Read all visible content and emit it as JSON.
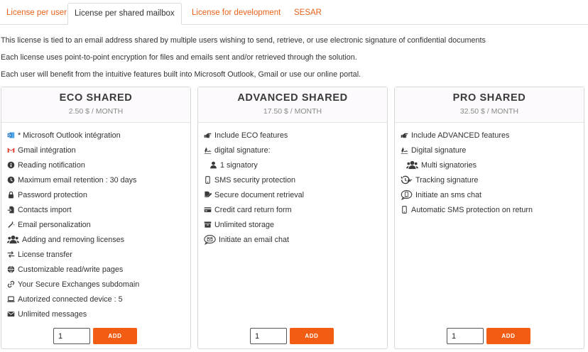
{
  "tabs": [
    {
      "label": "License per user",
      "active": false
    },
    {
      "label": "License per shared mailbox",
      "active": true
    },
    {
      "label": "License for development",
      "active": false
    },
    {
      "label": "SESAR",
      "active": false
    }
  ],
  "intro": [
    "This license is tied to an email address shared by multiple users wishing to send, retrieve, or use electronic signature of confidential documents",
    "Each license uses point-to-point encryption for files and emails sent and/or retrieved through the solution.",
    "Each user will benefit from the intuitive features built into Microsoft Outlook, Gmail or use our online portal."
  ],
  "plans": [
    {
      "title": "ECO SHARED",
      "price": "2.50 $ / MONTH",
      "features": [
        {
          "icon": "outlook-icon",
          "label": "* Microsoft Outlook intégration"
        },
        {
          "icon": "gmail-icon",
          "label": "Gmail intégration"
        },
        {
          "icon": "info-circle-icon",
          "label": "Reading notification"
        },
        {
          "icon": "clock-icon",
          "label": "Maximum email retention : 30 days"
        },
        {
          "icon": "lock-icon",
          "label": "Password protection"
        },
        {
          "icon": "file-import-icon",
          "label": "Contacts import"
        },
        {
          "icon": "magic-wand-icon",
          "label": "Email personalization"
        },
        {
          "icon": "users-icon",
          "label": "Adding and removing licenses"
        },
        {
          "icon": "exchange-icon",
          "label": "License transfer"
        },
        {
          "icon": "globe-icon",
          "label": "Customizable read/write pages"
        },
        {
          "icon": "link-icon",
          "label": "Your Secure Exchanges subdomain"
        },
        {
          "icon": "laptop-icon",
          "label": "Autorized connected device : 5"
        },
        {
          "icon": "envelope-icon",
          "label": "Unlimited messages"
        }
      ],
      "quantity": "1",
      "add_label": "ADD"
    },
    {
      "title": "ADVANCED SHARED",
      "price": "17.50 $ / MONTH",
      "features": [
        {
          "icon": "hand-pointing-icon",
          "label": "Include ECO features"
        },
        {
          "icon": "signature-icon",
          "label": "digital signature:"
        },
        {
          "icon": "user-icon",
          "label": "1 signatory",
          "indent": true
        },
        {
          "icon": "mobile-icon",
          "label": "SMS security protection"
        },
        {
          "icon": "file-signature-icon",
          "label": "Secure document retrieval"
        },
        {
          "icon": "credit-card-icon",
          "label": "Credit card return form"
        },
        {
          "icon": "archive-icon",
          "label": "Unlimited storage"
        },
        {
          "icon": "email-chat-icon",
          "label": "Initiate an email chat"
        }
      ],
      "quantity": "1",
      "add_label": "ADD"
    },
    {
      "title": "PRO SHARED",
      "price": "32.50 $ / MONTH",
      "features": [
        {
          "icon": "hand-pointing-icon",
          "label": "Include ADVANCED features"
        },
        {
          "icon": "signature-icon",
          "label": "Digital signature"
        },
        {
          "icon": "users-icon",
          "label": "Multi signatories",
          "indent": true
        },
        {
          "icon": "history-signature-icon",
          "label": "Tracking signature"
        },
        {
          "icon": "sms-chat-icon",
          "label": "Initiate an sms chat"
        },
        {
          "icon": "mobile-icon",
          "label": "Automatic SMS protection on return"
        }
      ],
      "quantity": "1",
      "add_label": "ADD"
    }
  ],
  "colors": {
    "accent": "#e8611a",
    "button": "#f25c13",
    "outlook_blue": "#0f6cbd",
    "gmail_red": "#ea4335"
  }
}
